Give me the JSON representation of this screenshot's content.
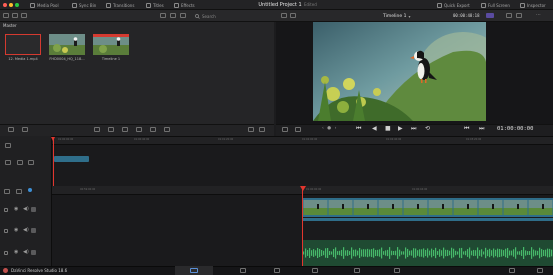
{
  "topbar": {
    "tabs": [
      {
        "label": "Media Pool",
        "icon": "media-pool-icon"
      },
      {
        "label": "Sync Bin",
        "icon": "sync-bin-icon"
      },
      {
        "label": "Transitions",
        "icon": "transitions-icon"
      },
      {
        "label": "Titles",
        "icon": "titles-icon"
      },
      {
        "label": "Effects",
        "icon": "effects-icon"
      }
    ],
    "project_title": "Untitled Project 1",
    "edited_label": "Edited",
    "right_tabs": [
      {
        "label": "Quick Export",
        "icon": "quick-export-icon"
      },
      {
        "label": "Full Screen",
        "icon": "full-screen-icon"
      },
      {
        "label": "Inspector",
        "icon": "inspector-icon"
      }
    ]
  },
  "toolbar2": {
    "search_label": "Search",
    "timeline_name": "Timeline 1",
    "timecode": "00:00:48:18"
  },
  "media_pool": {
    "bin_label": "Master",
    "clips": [
      {
        "label": "12. Media 1.mp4"
      },
      {
        "label": "FHD0004_HQ_118..."
      },
      {
        "label": "Timeline 1"
      }
    ]
  },
  "viewer": {
    "timecode": "01:00:00:00"
  },
  "timeline_upper": {
    "ticks": [
      "01:00:00:00",
      "01:00:40:00",
      "01:01:20:00",
      "01:02:00:00",
      "01:02:40:00",
      "01:03:20:00"
    ]
  },
  "timeline_lower": {
    "ticks": [
      "00:59:00:00",
      "01:00:00:00",
      "01:00:04:00"
    ]
  },
  "bottombar": {
    "app_name": "DaVinci Resolve Studio 18.6"
  },
  "colors": {
    "accent": "#e2362e",
    "clip_video": "#2f6e8a",
    "clip_audio": "#2a8a4b",
    "selected_clip_border": "#d43a30"
  }
}
